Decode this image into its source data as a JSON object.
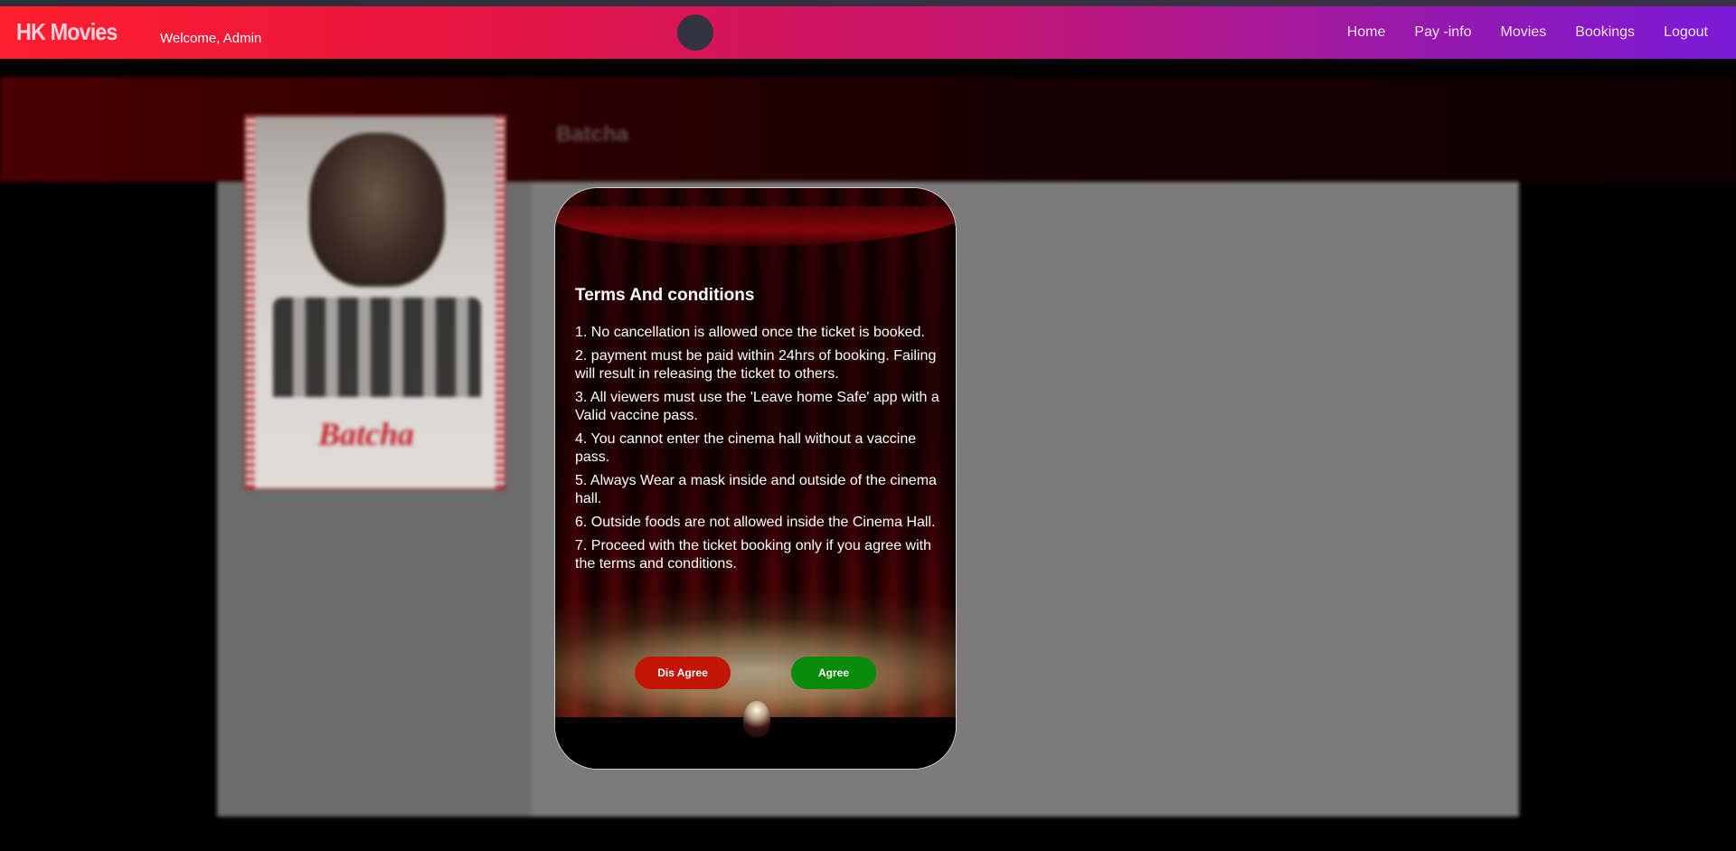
{
  "navbar": {
    "brand": "HK Movies",
    "welcome": "Welcome, Admin",
    "links": [
      "Home",
      "Pay -info",
      "Movies",
      "Bookings",
      "Logout"
    ]
  },
  "background": {
    "movie_title": "Batcha",
    "poster_title": "Batcha"
  },
  "modal": {
    "title": "Terms And conditions",
    "terms": [
      "1. No cancellation is allowed once the ticket is booked.",
      "2. payment must be paid within 24hrs of booking. Failing will result in releasing the ticket to others.",
      "3. All viewers must use the 'Leave home Safe' app with a Valid vaccine pass.",
      "4. You cannot enter the cinema hall without a vaccine pass.",
      "5. Always Wear a mask inside and outside of the cinema hall.",
      "6. Outside foods are not allowed inside the Cinema Hall.",
      "7. Proceed with the ticket booking only if you agree with the terms and conditions."
    ],
    "disagree_label": "Dis Agree",
    "agree_label": "Agree"
  },
  "colors": {
    "disagree": "#c21505",
    "agree": "#0b8b0b",
    "nav_start": "#ff1e2d",
    "nav_end": "#7a1ad8"
  }
}
